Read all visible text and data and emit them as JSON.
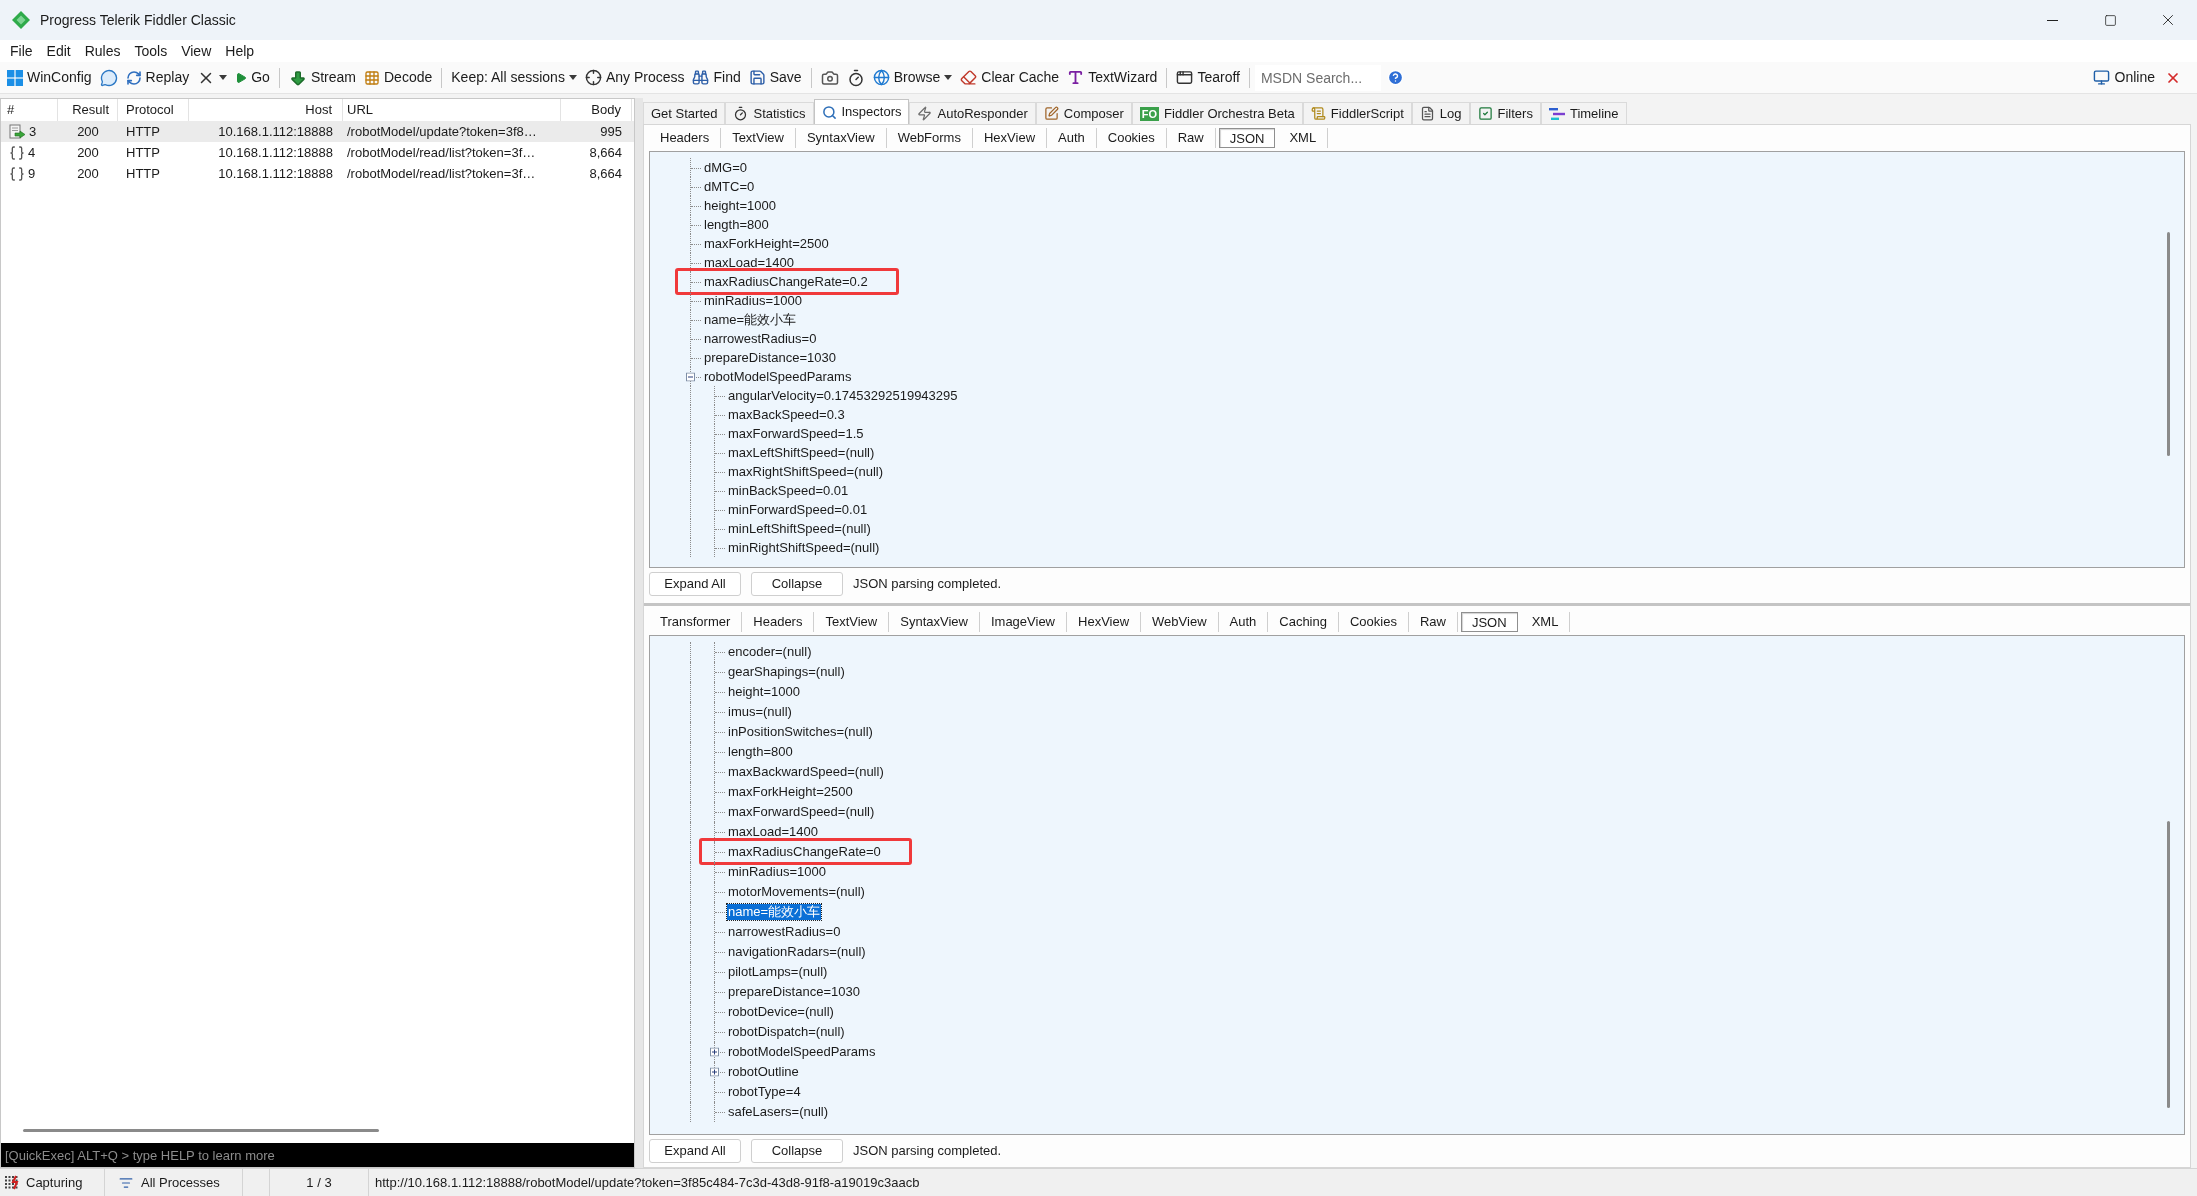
{
  "window": {
    "title": "Progress Telerik Fiddler Classic"
  },
  "menu": [
    "File",
    "Edit",
    "Rules",
    "Tools",
    "View",
    "Help"
  ],
  "toolbar": {
    "groups": [
      [
        {
          "label": "WinConfig",
          "dropdown": false
        },
        {
          "dropdown": false
        },
        {
          "label": "Replay",
          "dropdown": false
        },
        {
          "dropdown": true
        },
        {
          "label": "Go",
          "dropdown": false
        }
      ],
      [
        {
          "label": "Stream",
          "dropdown": false
        },
        {
          "label": "Decode",
          "dropdown": false
        }
      ],
      [
        {
          "label": "Keep: All sessions",
          "dropdown": true
        },
        {
          "label": "Any Process",
          "dropdown": false
        },
        {
          "label": "Find",
          "dropdown": false
        },
        {
          "label": "Save",
          "dropdown": false
        }
      ],
      [
        {
          "dropdown": false
        },
        {
          "dropdown": false
        },
        {
          "label": "Browse",
          "dropdown": true
        },
        {
          "label": "Clear Cache",
          "dropdown": false
        },
        {
          "label": "TextWizard",
          "dropdown": false
        }
      ],
      [
        {
          "label": "Tearoff",
          "dropdown": false
        }
      ]
    ],
    "search": {
      "placeholder": "MSDN Search..."
    },
    "online": {
      "label": "Online"
    }
  },
  "sessions": {
    "columns": [
      "#",
      "Result",
      "Protocol",
      "Host",
      "URL",
      "Body"
    ],
    "rows": [
      {
        "kind": "request",
        "id": "3",
        "result": "200",
        "protocol": "HTTP",
        "host": "10.168.1.112:18888",
        "url": "/robotModel/update?token=3f8…",
        "body": "995",
        "selected": true
      },
      {
        "kind": "json",
        "id": "4",
        "result": "200",
        "protocol": "HTTP",
        "host": "10.168.1.112:18888",
        "url": "/robotModel/read/list?token=3f…",
        "body": "8,664",
        "selected": false
      },
      {
        "kind": "json",
        "id": "9",
        "result": "200",
        "protocol": "HTTP",
        "host": "10.168.1.112:18888",
        "url": "/robotModel/read/list?token=3f…",
        "body": "8,664",
        "selected": false
      }
    ]
  },
  "quickexec": {
    "placeholder": "[QuickExec] ALT+Q > type HELP to learn more"
  },
  "inspector_tabs": [
    {
      "label": "Get Started",
      "selected": false
    },
    {
      "label": "Statistics",
      "selected": false
    },
    {
      "label": "Inspectors",
      "selected": true
    },
    {
      "label": "AutoResponder",
      "selected": false
    },
    {
      "label": "Composer",
      "selected": false
    },
    {
      "label": "Fiddler Orchestra Beta",
      "badge": "FO",
      "selected": false
    },
    {
      "label": "FiddlerScript",
      "selected": false
    },
    {
      "label": "Log",
      "selected": false
    },
    {
      "label": "Filters",
      "selected": false
    },
    {
      "label": "Timeline",
      "selected": false
    }
  ],
  "request": {
    "tabs": [
      {
        "label": "Headers",
        "selected": false
      },
      {
        "label": "TextView",
        "selected": false
      },
      {
        "label": "SyntaxView",
        "selected": false
      },
      {
        "label": "WebForms",
        "selected": false
      },
      {
        "label": "HexView",
        "selected": false
      },
      {
        "label": "Auth",
        "selected": false
      },
      {
        "label": "Cookies",
        "selected": false
      },
      {
        "label": "Raw",
        "selected": false
      },
      {
        "label": "JSON",
        "selected": true
      },
      {
        "label": "XML",
        "selected": false
      }
    ],
    "tree": [
      {
        "text": "dMG=0",
        "selected": false,
        "boxed": false
      },
      {
        "text": "dMTC=0",
        "selected": false,
        "boxed": false
      },
      {
        "text": "height=1000",
        "selected": false,
        "boxed": false
      },
      {
        "text": "length=800",
        "selected": false,
        "boxed": false
      },
      {
        "text": "maxForkHeight=2500",
        "selected": false,
        "boxed": false
      },
      {
        "text": "maxLoad=1400",
        "selected": false,
        "boxed": false
      },
      {
        "text": "maxRadiusChangeRate=0.2",
        "selected": false,
        "boxed": true
      },
      {
        "text": "minRadius=1000",
        "selected": false,
        "boxed": false
      },
      {
        "text": "name=能效小车",
        "selected": false,
        "boxed": false
      },
      {
        "text": "narrowestRadius=0",
        "selected": false,
        "boxed": false
      },
      {
        "text": "prepareDistance=1030",
        "selected": false,
        "boxed": false
      },
      {
        "text": "robotModelSpeedParams",
        "expanded": true,
        "selected": false,
        "boxed": false,
        "children": [
          {
            "text": "angularVelocity=0.17453292519943295",
            "selected": false,
            "boxed": false
          },
          {
            "text": "maxBackSpeed=0.3",
            "selected": false,
            "boxed": false
          },
          {
            "text": "maxForwardSpeed=1.5",
            "selected": false,
            "boxed": false
          },
          {
            "text": "maxLeftShiftSpeed=(null)",
            "selected": false,
            "boxed": false
          },
          {
            "text": "maxRightShiftSpeed=(null)",
            "selected": false,
            "boxed": false
          },
          {
            "text": "minBackSpeed=0.01",
            "selected": false,
            "boxed": false
          },
          {
            "text": "minForwardSpeed=0.01",
            "selected": false,
            "boxed": false
          },
          {
            "text": "minLeftShiftSpeed=(null)",
            "selected": false,
            "boxed": false
          },
          {
            "text": "minRightShiftSpeed=(null)",
            "selected": false,
            "boxed": false
          }
        ]
      }
    ],
    "buttons": [
      "Expand All",
      "Collapse"
    ],
    "status": "JSON parsing completed."
  },
  "response": {
    "tabs": [
      {
        "label": "Transformer",
        "selected": false
      },
      {
        "label": "Headers",
        "selected": false
      },
      {
        "label": "TextView",
        "selected": false
      },
      {
        "label": "SyntaxView",
        "selected": false
      },
      {
        "label": "ImageView",
        "selected": false
      },
      {
        "label": "HexView",
        "selected": false
      },
      {
        "label": "WebView",
        "selected": false
      },
      {
        "label": "Auth",
        "selected": false
      },
      {
        "label": "Caching",
        "selected": false
      },
      {
        "label": "Cookies",
        "selected": false
      },
      {
        "label": "Raw",
        "selected": false
      },
      {
        "label": "JSON",
        "selected": true
      },
      {
        "label": "XML",
        "selected": false
      }
    ],
    "tree": [
      {
        "text": "encoder=(null)",
        "selected": false,
        "boxed": false
      },
      {
        "text": "gearShapings=(null)",
        "selected": false,
        "boxed": false
      },
      {
        "text": "height=1000",
        "selected": false,
        "boxed": false
      },
      {
        "text": "imus=(null)",
        "selected": false,
        "boxed": false
      },
      {
        "text": "inPositionSwitches=(null)",
        "selected": false,
        "boxed": false
      },
      {
        "text": "length=800",
        "selected": false,
        "boxed": false
      },
      {
        "text": "maxBackwardSpeed=(null)",
        "selected": false,
        "boxed": false
      },
      {
        "text": "maxForkHeight=2500",
        "selected": false,
        "boxed": false
      },
      {
        "text": "maxForwardSpeed=(null)",
        "selected": false,
        "boxed": false
      },
      {
        "text": "maxLoad=1400",
        "selected": false,
        "boxed": false
      },
      {
        "text": "maxRadiusChangeRate=0",
        "selected": false,
        "boxed": true
      },
      {
        "text": "minRadius=1000",
        "selected": false,
        "boxed": false
      },
      {
        "text": "motorMovements=(null)",
        "selected": false,
        "boxed": false
      },
      {
        "text": "name=能效小车",
        "selected": true,
        "boxed": false
      },
      {
        "text": "narrowestRadius=0",
        "selected": false,
        "boxed": false
      },
      {
        "text": "navigationRadars=(null)",
        "selected": false,
        "boxed": false
      },
      {
        "text": "pilotLamps=(null)",
        "selected": false,
        "boxed": false
      },
      {
        "text": "prepareDistance=1030",
        "selected": false,
        "boxed": false
      },
      {
        "text": "robotDevice=(null)",
        "selected": false,
        "boxed": false
      },
      {
        "text": "robotDispatch=(null)",
        "selected": false,
        "boxed": false
      },
      {
        "text": "robotModelSpeedParams",
        "expanded": false,
        "selected": false,
        "boxed": false
      },
      {
        "text": "robotOutline",
        "expanded": false,
        "selected": false,
        "boxed": false
      },
      {
        "text": "robotType=4",
        "selected": false,
        "boxed": false
      },
      {
        "text": "safeLasers=(null)",
        "selected": false,
        "boxed": false
      }
    ],
    "buttons": [
      "Expand All",
      "Collapse"
    ],
    "status": "JSON parsing completed."
  },
  "status_bar": {
    "capture": "Capturing",
    "processes": "All Processes",
    "count": "1 / 3",
    "url": "http://10.168.1.112:18888/robotModel/update?token=3f85c484-7c3d-43d8-91f8-a19019c3aacb"
  }
}
